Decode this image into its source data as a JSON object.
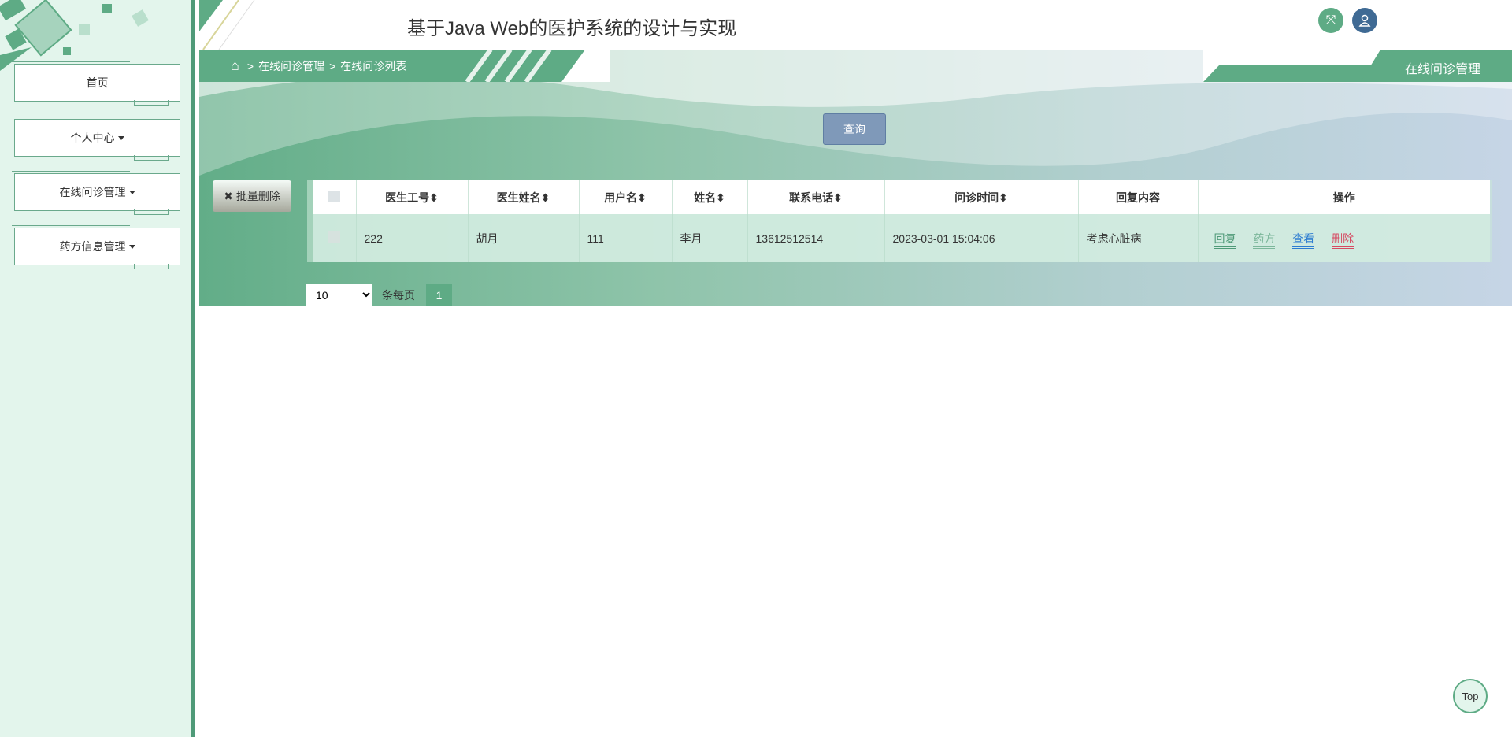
{
  "header": {
    "title": "基于Java Web的医护系统的设计与实现"
  },
  "sidebar": {
    "items": [
      {
        "label": "首页"
      },
      {
        "label": "个人中心"
      },
      {
        "label": "在线问诊管理"
      },
      {
        "label": "药方信息管理"
      }
    ]
  },
  "breadcrumb": {
    "items": [
      "在线问诊管理",
      "在线问诊列表"
    ],
    "sep": ">"
  },
  "page_label": "在线问诊管理",
  "search": {
    "button": "查询"
  },
  "toolbar": {
    "batch_delete": "批量删除"
  },
  "table": {
    "columns": [
      "医生工号",
      "医生姓名",
      "用户名",
      "姓名",
      "联系电话",
      "问诊时间",
      "回复内容",
      "操作"
    ],
    "rows": [
      {
        "cells": [
          "222",
          "胡月",
          "111",
          "李月",
          "13612512514",
          "2023-03-01 15:04:06",
          "考虑心脏病"
        ],
        "actions": [
          "回复",
          "药方",
          "查看",
          "删除"
        ]
      }
    ]
  },
  "pagination": {
    "page_size": "10",
    "per_page_label": "条每页",
    "current_page": "1"
  },
  "top_button": "Top",
  "colors": {
    "primary": "#5eab85",
    "sidebar_bg": "#e3f5ec",
    "view": "#2e7dd1",
    "delete": "#d64a62"
  }
}
